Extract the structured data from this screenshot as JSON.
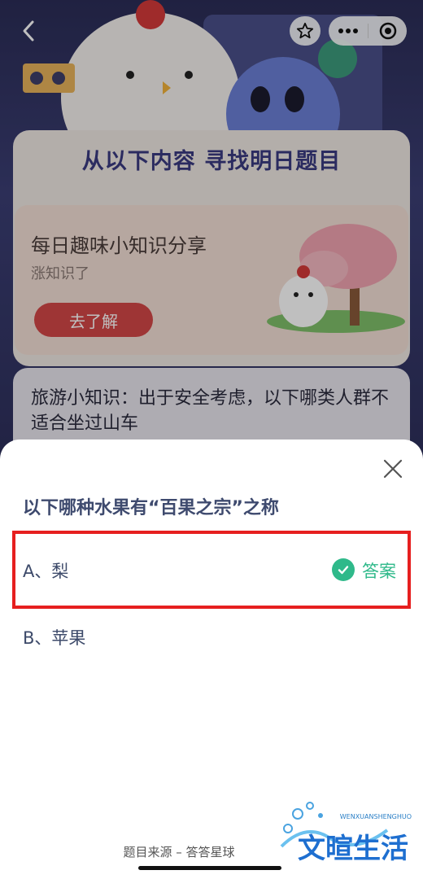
{
  "header": {
    "back_icon": "chevron-left-icon",
    "star_icon": "star-icon",
    "more_icon": "more-icon",
    "target_icon": "target-icon"
  },
  "page": {
    "card_title": "从以下内容 寻找明日题目",
    "share_title": "每日趣味小知识分享",
    "share_subtitle": "涨知识了",
    "share_button": "去了解",
    "tip_text": "旅游小知识：出于安全考虑，以下哪类人群不适合坐过山车"
  },
  "sheet": {
    "question": "以下哪种水果有“百果之宗”之称",
    "options": [
      {
        "label": "A、梨",
        "is_answer": true
      },
      {
        "label": "B、苹果",
        "is_answer": false
      }
    ],
    "answer_label": "答案",
    "source": "题目来源 – 答答星球"
  },
  "watermark": {
    "text": "文暄生活",
    "sub": "WENXUANSHENGHUO"
  },
  "colors": {
    "accent_red": "#e61f1f",
    "answer_green": "#2fb98a",
    "button_red": "#d34747"
  }
}
